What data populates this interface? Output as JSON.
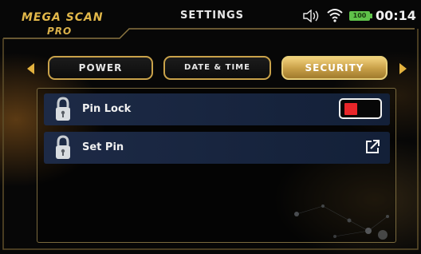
{
  "header": {
    "brand_line1": "MEGA SCAN",
    "brand_line2": "PRO",
    "title": "SETTINGS",
    "battery_level": "100",
    "time": "00:14",
    "icons": [
      "volume-icon",
      "wifi-icon",
      "battery-icon"
    ]
  },
  "tabs": [
    {
      "label": "POWER",
      "active": false
    },
    {
      "label": "DATE & TIME",
      "active": false
    },
    {
      "label": "SECURITY",
      "active": true
    }
  ],
  "settings": [
    {
      "label": "Pin Lock",
      "icon": "padlock-icon",
      "control": "toggle",
      "toggle_state": "off"
    },
    {
      "label": "Set Pin",
      "icon": "padlock-icon",
      "control": "edit",
      "control_icon": "external-edit-icon"
    }
  ],
  "colors": {
    "accent_gold": "#e3b23f",
    "row_background": "#1d2a46",
    "toggle_red": "#e8262a",
    "battery_green": "#5fc24a"
  }
}
